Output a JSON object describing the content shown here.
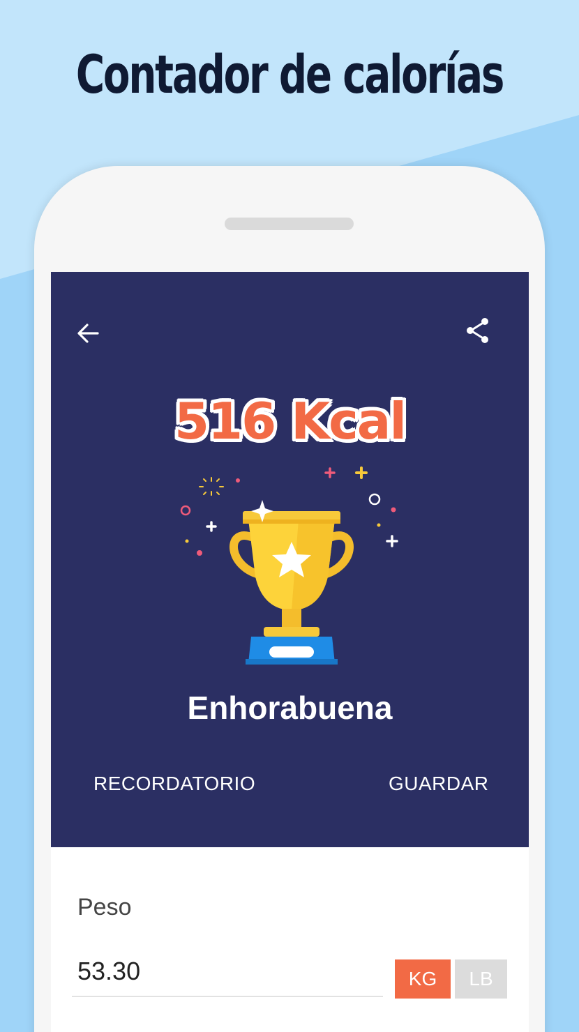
{
  "promo": {
    "title": "Contador de calorías"
  },
  "toolbar": {
    "back_icon": "arrow-left-icon",
    "share_icon": "share-icon"
  },
  "result": {
    "kcal": "516 Kcal",
    "message": "Enhorabuena",
    "trophy_icon": "trophy-icon"
  },
  "actions": {
    "reminder": "RECORDATORIO",
    "save": "GUARDAR"
  },
  "weight": {
    "label": "Peso",
    "value": "53.30",
    "units": {
      "kg": "KG",
      "lb": "LB",
      "selected": "KG"
    }
  },
  "colors": {
    "hero_bg": "#2b2f63",
    "accent": "#f26a45",
    "trophy_gold": "#fdd33a",
    "trophy_base": "#1f8ce6"
  }
}
